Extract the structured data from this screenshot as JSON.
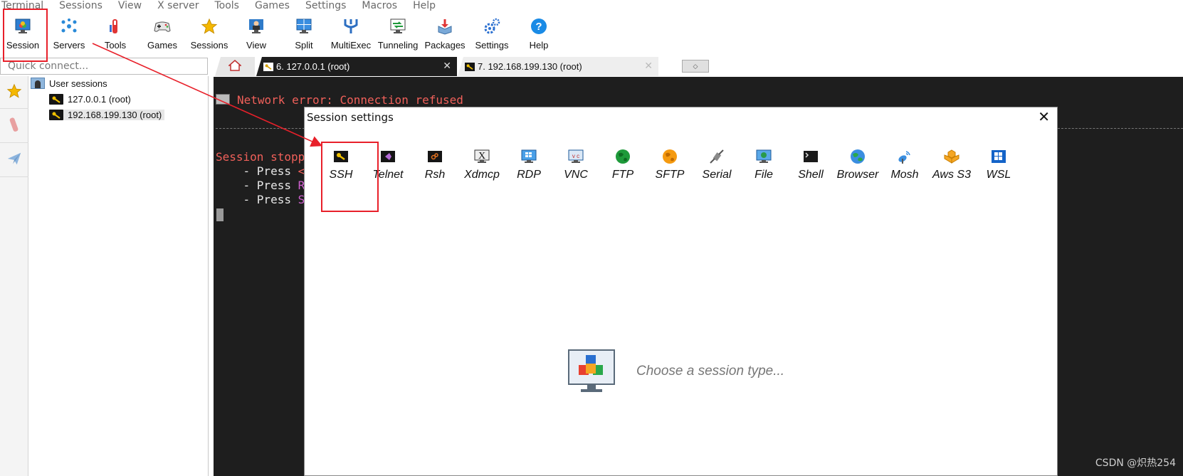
{
  "menubar": {
    "items": [
      "Terminal",
      "Sessions",
      "View",
      "X server",
      "Tools",
      "Games",
      "Settings",
      "Macros",
      "Help"
    ]
  },
  "toolbar": {
    "items": [
      {
        "label": "Session",
        "icon": "session-monitor-icon"
      },
      {
        "label": "Servers",
        "icon": "servers-icon"
      },
      {
        "label": "Tools",
        "icon": "tools-icon"
      },
      {
        "label": "Games",
        "icon": "gamepad-icon"
      },
      {
        "label": "Sessions",
        "icon": "star-icon"
      },
      {
        "label": "View",
        "icon": "view-icon"
      },
      {
        "label": "Split",
        "icon": "split-icon"
      },
      {
        "label": "MultiExec",
        "icon": "multiexec-icon"
      },
      {
        "label": "Tunneling",
        "icon": "tunneling-icon"
      },
      {
        "label": "Packages",
        "icon": "packages-icon"
      },
      {
        "label": "Settings",
        "icon": "settings-gears-icon"
      },
      {
        "label": "Help",
        "icon": "help-icon"
      }
    ]
  },
  "quick_connect": {
    "placeholder": "Quick connect..."
  },
  "sidebar": {
    "root_label": "User sessions",
    "sessions": [
      {
        "label": "127.0.0.1 (root)"
      },
      {
        "label": "192.168.199.130 (root)"
      }
    ]
  },
  "tabs": [
    {
      "label": "6. 127.0.0.1 (root)",
      "active": true
    },
    {
      "label": "7. 192.168.199.130 (root)",
      "active": false
    }
  ],
  "terminal": {
    "lines": [
      {
        "text": "Network error: Connection refused",
        "color": "#f0605a"
      },
      {
        "text": "Session stopp",
        "color": "#f0605a"
      },
      {
        "text": "    - Press ",
        "color": "#e8e8e8",
        "tail": "<",
        "tail_color": "#f0605a"
      },
      {
        "text": "    - Press ",
        "color": "#e8e8e8",
        "tail": "R",
        "tail_color": "#d060d0"
      },
      {
        "text": "    - Press ",
        "color": "#e8e8e8",
        "tail": "S",
        "tail_color": "#d060d0"
      }
    ]
  },
  "dialog": {
    "title": "Session settings",
    "close_glyph": "✕",
    "session_types": [
      {
        "label": "SSH",
        "icon": "ssh-key-icon"
      },
      {
        "label": "Telnet",
        "icon": "telnet-icon"
      },
      {
        "label": "Rsh",
        "icon": "rsh-icon"
      },
      {
        "label": "Xdmcp",
        "icon": "xdmcp-icon"
      },
      {
        "label": "RDP",
        "icon": "rdp-icon"
      },
      {
        "label": "VNC",
        "icon": "vnc-icon"
      },
      {
        "label": "FTP",
        "icon": "ftp-globe-icon"
      },
      {
        "label": "SFTP",
        "icon": "sftp-globe-icon"
      },
      {
        "label": "Serial",
        "icon": "serial-cable-icon"
      },
      {
        "label": "File",
        "icon": "file-monitor-icon"
      },
      {
        "label": "Shell",
        "icon": "shell-icon"
      },
      {
        "label": "Browser",
        "icon": "browser-globe-icon"
      },
      {
        "label": "Mosh",
        "icon": "mosh-antenna-icon"
      },
      {
        "label": "Aws S3",
        "icon": "aws-s3-icon"
      },
      {
        "label": "WSL",
        "icon": "wsl-windows-icon"
      }
    ],
    "placeholder": "Choose a session type..."
  },
  "watermark": "CSDN @炽热254",
  "colors": {
    "annotation_red": "#e8202a",
    "terminal_bg": "#1e1e1e",
    "error_text": "#f0605a"
  }
}
